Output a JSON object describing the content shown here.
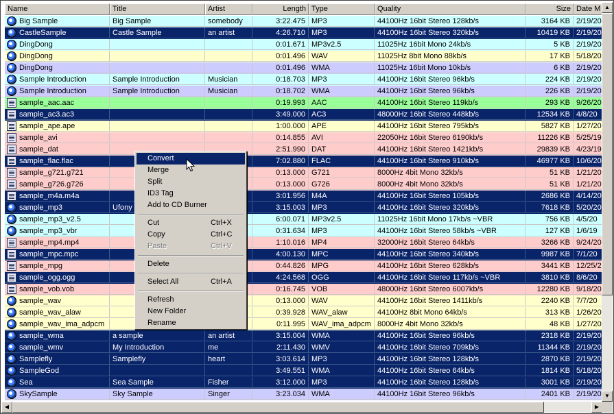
{
  "columns": [
    {
      "key": "name",
      "label": "Name"
    },
    {
      "key": "title",
      "label": "Title"
    },
    {
      "key": "artist",
      "label": "Artist"
    },
    {
      "key": "length",
      "label": "Length"
    },
    {
      "key": "type",
      "label": "Type"
    },
    {
      "key": "quality",
      "label": "Quality"
    },
    {
      "key": "size",
      "label": "Size"
    },
    {
      "key": "date",
      "label": "Date M"
    }
  ],
  "colors": {
    "selected": "#0a246a",
    "cyan": "#ccffff",
    "yellow": "#ffffcc",
    "lavender": "#ccccff",
    "green": "#99ff99",
    "pink": "#ffcccc"
  },
  "rows": [
    {
      "name": "Big Sample",
      "title": "Big Sample",
      "artist": "somebody",
      "length": "3:22.475",
      "type": "MP3",
      "quality": "44100Hz 16bit Stereo 128kb/s",
      "size": "3164 KB",
      "date": "2/19/20",
      "bg": "cyan",
      "sel": false,
      "icon": "audio-file-icon"
    },
    {
      "name": "CastleSample",
      "title": "Castle Sample",
      "artist": "an artist",
      "length": "4:26.710",
      "type": "MP3",
      "quality": "44100Hz 16bit Stereo 320kb/s",
      "size": "10419 KB",
      "date": "2/19/20",
      "bg": "",
      "sel": true,
      "icon": "audio-file-icon"
    },
    {
      "name": "DingDong",
      "title": "",
      "artist": "",
      "length": "0:01.671",
      "type": "MP3v2.5",
      "quality": "11025Hz 16bit Mono 24kb/s",
      "size": "5 KB",
      "date": "2/19/20",
      "bg": "cyan",
      "sel": false,
      "icon": "audio-file-icon"
    },
    {
      "name": "DingDong",
      "title": "",
      "artist": "",
      "length": "0:01.496",
      "type": "WAV",
      "quality": "11025Hz  8bit Mono 88kb/s",
      "size": "17 KB",
      "date": "5/18/20",
      "bg": "yellow",
      "sel": false,
      "icon": "audio-file-icon"
    },
    {
      "name": "DingDong",
      "title": "",
      "artist": "",
      "length": "0:01.496",
      "type": "WMA",
      "quality": "11025Hz 16bit Mono 10kb/s",
      "size": "6 KB",
      "date": "2/19/20",
      "bg": "lavender",
      "sel": false,
      "icon": "audio-file-icon"
    },
    {
      "name": "Sample Introduction",
      "title": "Sample Introduction",
      "artist": "Musician",
      "length": "0:18.703",
      "type": "MP3",
      "quality": "44100Hz 16bit Stereo 96kb/s",
      "size": "224 KB",
      "date": "2/19/20",
      "bg": "cyan",
      "sel": false,
      "icon": "audio-file-icon"
    },
    {
      "name": "Sample Introduction",
      "title": "Sample Introduction",
      "artist": "Musician",
      "length": "0:18.702",
      "type": "WMA",
      "quality": "44100Hz 16bit Stereo 96kb/s",
      "size": "226 KB",
      "date": "2/19/20",
      "bg": "lavender",
      "sel": false,
      "icon": "audio-file-icon"
    },
    {
      "name": "sample_aac.aac",
      "title": "",
      "artist": "",
      "length": "0:19.993",
      "type": "AAC",
      "quality": "44100Hz 16bit Stereo 119kb/s",
      "size": "293 KB",
      "date": "9/26/20",
      "bg": "green",
      "sel": false,
      "icon": "document-file-icon"
    },
    {
      "name": "sample_ac3.ac3",
      "title": "",
      "artist": "",
      "length": "3:49.000",
      "type": "AC3",
      "quality": "48000Hz 16bit Stereo 448kb/s",
      "size": "12534 KB",
      "date": "4/8/20",
      "bg": "",
      "sel": true,
      "icon": "document-file-icon"
    },
    {
      "name": "sample_ape.ape",
      "title": "",
      "artist": "",
      "length": "1:00.000",
      "type": "APE",
      "quality": "44100Hz 16bit Stereo 795kb/s",
      "size": "5827 KB",
      "date": "1/27/20",
      "bg": "yellow",
      "sel": false,
      "icon": "document-file-icon"
    },
    {
      "name": "sample_avi",
      "title": "",
      "artist": "",
      "length": "0:14.855",
      "type": "AVI",
      "quality": "22050Hz 16bit Stereo 6190kb/s",
      "size": "11226 KB",
      "date": "5/25/19",
      "bg": "pink",
      "sel": false,
      "icon": "document-file-icon"
    },
    {
      "name": "sample_dat",
      "title": "",
      "artist": "",
      "length": "2:51.990",
      "type": "DAT",
      "quality": "44100Hz 16bit Stereo 1421kb/s",
      "size": "29839 KB",
      "date": "4/23/19",
      "bg": "pink",
      "sel": false,
      "icon": "document-file-icon"
    },
    {
      "name": "sample_flac.flac",
      "title": "",
      "artist": "",
      "length": "7:02.880",
      "type": "FLAC",
      "quality": "44100Hz 16bit Stereo 910kb/s",
      "size": "46977 KB",
      "date": "10/6/20",
      "bg": "",
      "sel": true,
      "icon": "document-file-icon"
    },
    {
      "name": "sample_g721.g721",
      "title": "",
      "artist": "",
      "length": "0:13.000",
      "type": "G721",
      "quality": "8000Hz  4bit Mono 32kb/s",
      "size": "51 KB",
      "date": "1/21/20",
      "bg": "pink",
      "sel": false,
      "icon": "document-file-icon"
    },
    {
      "name": "sample_g726.g726",
      "title": "",
      "artist": "",
      "length": "0:13.000",
      "type": "G726",
      "quality": "8000Hz  4bit Mono 32kb/s",
      "size": "51 KB",
      "date": "1/21/20",
      "bg": "pink",
      "sel": false,
      "icon": "document-file-icon"
    },
    {
      "name": "sample_m4a.m4a",
      "title": "",
      "artist": "",
      "length": "3:01.956",
      "type": "M4A",
      "quality": "44100Hz 16bit Stereo 105kb/s",
      "size": "2686 KB",
      "date": "4/14/20",
      "bg": "",
      "sel": true,
      "icon": "document-file-icon"
    },
    {
      "name": "sample_mp3",
      "title": "Ufony",
      "artist": "",
      "length": "3:15.003",
      "type": "MP3",
      "quality": "44100Hz 16bit Stereo 320kb/s",
      "size": "7618 KB",
      "date": "5/20/20",
      "bg": "",
      "sel": true,
      "icon": "audio-file-icon"
    },
    {
      "name": "sample_mp3_v2.5",
      "title": "",
      "artist": "",
      "length": "6:00.071",
      "type": "MP3v2.5",
      "quality": "11025Hz 16bit Mono 17kb/s ~VBR",
      "size": "756 KB",
      "date": "4/5/20",
      "bg": "cyan",
      "sel": false,
      "icon": "audio-file-icon"
    },
    {
      "name": "sample_mp3_vbr",
      "title": "",
      "artist": "",
      "length": "0:31.634",
      "type": "MP3",
      "quality": "44100Hz 16bit Stereo 58kb/s ~VBR",
      "size": "127 KB",
      "date": "1/6/19",
      "bg": "cyan",
      "sel": false,
      "icon": "audio-file-icon"
    },
    {
      "name": "sample_mp4.mp4",
      "title": "",
      "artist": "",
      "length": "1:10.016",
      "type": "MP4",
      "quality": "32000Hz 16bit Stereo 64kb/s",
      "size": "3266 KB",
      "date": "9/24/20",
      "bg": "pink",
      "sel": false,
      "icon": "document-file-icon"
    },
    {
      "name": "sample_mpc.mpc",
      "title": "",
      "artist": "",
      "length": "4:00.130",
      "type": "MPC",
      "quality": "44100Hz 16bit Stereo 340kb/s",
      "size": "9987 KB",
      "date": "7/1/20",
      "bg": "",
      "sel": true,
      "icon": "document-file-icon"
    },
    {
      "name": "sample_mpg",
      "title": "",
      "artist": "",
      "length": "0:44.826",
      "type": "MPG",
      "quality": "44100Hz 16bit Stereo 628kb/s",
      "size": "3441 KB",
      "date": "12/25/2",
      "bg": "pink",
      "sel": false,
      "icon": "document-file-icon"
    },
    {
      "name": "sample_ogg.ogg",
      "title": "",
      "artist": "",
      "length": "4:24.568",
      "type": "OGG",
      "quality": "44100Hz 16bit Stereo 117kb/s ~VBR",
      "size": "3810 KB",
      "date": "8/6/20",
      "bg": "",
      "sel": true,
      "icon": "document-file-icon"
    },
    {
      "name": "sample_vob.vob",
      "title": "",
      "artist": "",
      "length": "0:16.745",
      "type": "VOB",
      "quality": "48000Hz 16bit Stereo 6007kb/s",
      "size": "12280 KB",
      "date": "9/18/20",
      "bg": "pink",
      "sel": false,
      "icon": "document-file-icon"
    },
    {
      "name": "sample_wav",
      "title": "",
      "artist": "",
      "length": "0:13.000",
      "type": "WAV",
      "quality": "44100Hz 16bit Stereo 1411kb/s",
      "size": "2240 KB",
      "date": "7/7/20",
      "bg": "yellow",
      "sel": false,
      "icon": "audio-file-icon"
    },
    {
      "name": "sample_wav_alaw",
      "title": "",
      "artist": "",
      "length": "0:39.928",
      "type": "WAV_alaw",
      "quality": "44100Hz  8bit Mono 64kb/s",
      "size": "313 KB",
      "date": "1/26/20",
      "bg": "yellow",
      "sel": false,
      "icon": "audio-file-icon"
    },
    {
      "name": "sample_wav_ima_adpcm",
      "title": "",
      "artist": "",
      "length": "0:11.995",
      "type": "WAV_ima_adpcm",
      "quality": "8000Hz  4bit Mono 32kb/s",
      "size": "48 KB",
      "date": "1/27/20",
      "bg": "yellow",
      "sel": false,
      "icon": "audio-file-icon"
    },
    {
      "name": "sample_wma",
      "title": "a sample",
      "artist": "an artist",
      "length": "3:15.004",
      "type": "WMA",
      "quality": "44100Hz 16bit Stereo 96kb/s",
      "size": "2318 KB",
      "date": "2/19/20",
      "bg": "",
      "sel": true,
      "icon": "audio-file-icon"
    },
    {
      "name": "sample_wmv",
      "title": "My Introduction",
      "artist": "me",
      "length": "2:11.430",
      "type": "WMV",
      "quality": "44100Hz 16bit Stereo 709kb/s",
      "size": "11344 KB",
      "date": "2/19/20",
      "bg": "",
      "sel": true,
      "icon": "audio-file-icon"
    },
    {
      "name": "Samplefly",
      "title": "Samplefly",
      "artist": "heart",
      "length": "3:03.614",
      "type": "MP3",
      "quality": "44100Hz 16bit Stereo 128kb/s",
      "size": "2870 KB",
      "date": "2/19/20",
      "bg": "",
      "sel": true,
      "icon": "audio-file-icon"
    },
    {
      "name": "SampleGod",
      "title": "",
      "artist": "",
      "length": "3:49.551",
      "type": "WMA",
      "quality": "44100Hz 16bit Stereo 64kb/s",
      "size": "1814 KB",
      "date": "5/18/20",
      "bg": "",
      "sel": true,
      "icon": "audio-file-icon"
    },
    {
      "name": "Sea",
      "title": "Sea Sample",
      "artist": "Fisher",
      "length": "3:12.000",
      "type": "MP3",
      "quality": "44100Hz 16bit Stereo 128kb/s",
      "size": "3001 KB",
      "date": "2/19/20",
      "bg": "",
      "sel": true,
      "icon": "audio-file-icon"
    },
    {
      "name": "SkySample",
      "title": "Sky Sample",
      "artist": "Singer",
      "length": "3:23.034",
      "type": "WMA",
      "quality": "44100Hz 16bit Stereo 96kb/s",
      "size": "2401 KB",
      "date": "2/19/20",
      "bg": "lavender",
      "sel": false,
      "icon": "audio-file-icon"
    }
  ],
  "context_menu": {
    "items": [
      {
        "label": "Convert",
        "shortcut": "",
        "highlighted": true,
        "disabled": false
      },
      {
        "label": "Merge",
        "shortcut": "",
        "highlighted": false,
        "disabled": false
      },
      {
        "label": "Split",
        "shortcut": "",
        "highlighted": false,
        "disabled": false
      },
      {
        "label": "ID3 Tag",
        "shortcut": "",
        "highlighted": false,
        "disabled": false
      },
      {
        "label": "Add to CD Burner",
        "shortcut": "",
        "highlighted": false,
        "disabled": false
      },
      {
        "separator": true
      },
      {
        "label": "Cut",
        "shortcut": "Ctrl+X",
        "highlighted": false,
        "disabled": false
      },
      {
        "label": "Copy",
        "shortcut": "Ctrl+C",
        "highlighted": false,
        "disabled": false
      },
      {
        "label": "Paste",
        "shortcut": "Ctrl+V",
        "highlighted": false,
        "disabled": true
      },
      {
        "separator": true
      },
      {
        "label": "Delete",
        "shortcut": "",
        "highlighted": false,
        "disabled": false
      },
      {
        "separator": true
      },
      {
        "label": "Select All",
        "shortcut": "Ctrl+A",
        "highlighted": false,
        "disabled": false
      },
      {
        "separator": true
      },
      {
        "label": "Refresh",
        "shortcut": "",
        "highlighted": false,
        "disabled": false
      },
      {
        "label": "New Folder",
        "shortcut": "",
        "highlighted": false,
        "disabled": false
      },
      {
        "label": "Rename",
        "shortcut": "",
        "highlighted": false,
        "disabled": false
      }
    ]
  }
}
